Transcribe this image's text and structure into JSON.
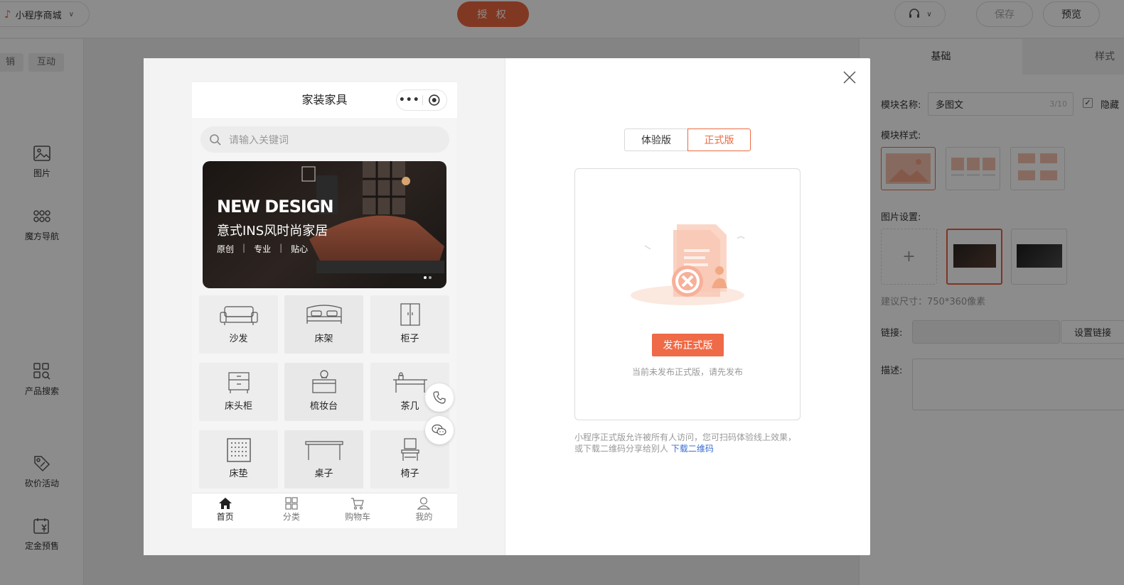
{
  "topbar": {
    "app_name": "小程序商城",
    "auth_label": "授 权",
    "save_label": "保存",
    "preview_label": "预览"
  },
  "leftbar": {
    "tabs": [
      "销",
      "互动"
    ],
    "components": [
      "图片",
      "魔方导航",
      "产品搜索",
      "砍价活动",
      "定金预售"
    ]
  },
  "rightbar": {
    "tabs": [
      "基础",
      "样式"
    ],
    "module_name_label": "模块名称:",
    "module_name_value": "多图文",
    "module_name_count": "3/10",
    "hide_label": "隐藏",
    "module_style_label": "模块样式:",
    "image_settings_label": "图片设置:",
    "size_hint": "建议尺寸：750*360像素",
    "link_label": "链接:",
    "set_link_label": "设置链接",
    "desc_label": "描述:"
  },
  "preview": {
    "page_title": "家装家具",
    "search_placeholder": "请输入关键词",
    "banner": {
      "headline": "NEW DESIGN",
      "subtitle": "意式INS风时尚家居",
      "tags": [
        "原创",
        "专业",
        "贴心"
      ]
    },
    "categories": [
      {
        "name": "沙发",
        "icon": "sofa-icon"
      },
      {
        "name": "床架",
        "icon": "bed-icon"
      },
      {
        "name": "柜子",
        "icon": "cabinet-icon"
      },
      {
        "name": "床头柜",
        "icon": "nightstand-icon"
      },
      {
        "name": "梳妆台",
        "icon": "dresser-icon"
      },
      {
        "name": "茶几",
        "icon": "tea-table-icon"
      },
      {
        "name": "床垫",
        "icon": "mattress-icon"
      },
      {
        "name": "桌子",
        "icon": "desk-icon"
      },
      {
        "name": "椅子",
        "icon": "chair-icon"
      }
    ],
    "tabbar": [
      {
        "label": "首页",
        "icon": "home-icon"
      },
      {
        "label": "分类",
        "icon": "category-icon"
      },
      {
        "label": "购物车",
        "icon": "cart-icon"
      },
      {
        "label": "我的",
        "icon": "user-icon"
      }
    ]
  },
  "publish": {
    "trial_label": "体验版",
    "official_label": "正式版",
    "publish_button": "发布正式版",
    "empty_tip": "当前未发布正式版，请先发布",
    "description": "小程序正式版允许被所有人访问，您可扫码体验线上效果，或下载二维码分享给别人",
    "download_link": "下载二维码"
  },
  "colors": {
    "accent": "#ee6a3f",
    "link": "#3a6fd0"
  }
}
